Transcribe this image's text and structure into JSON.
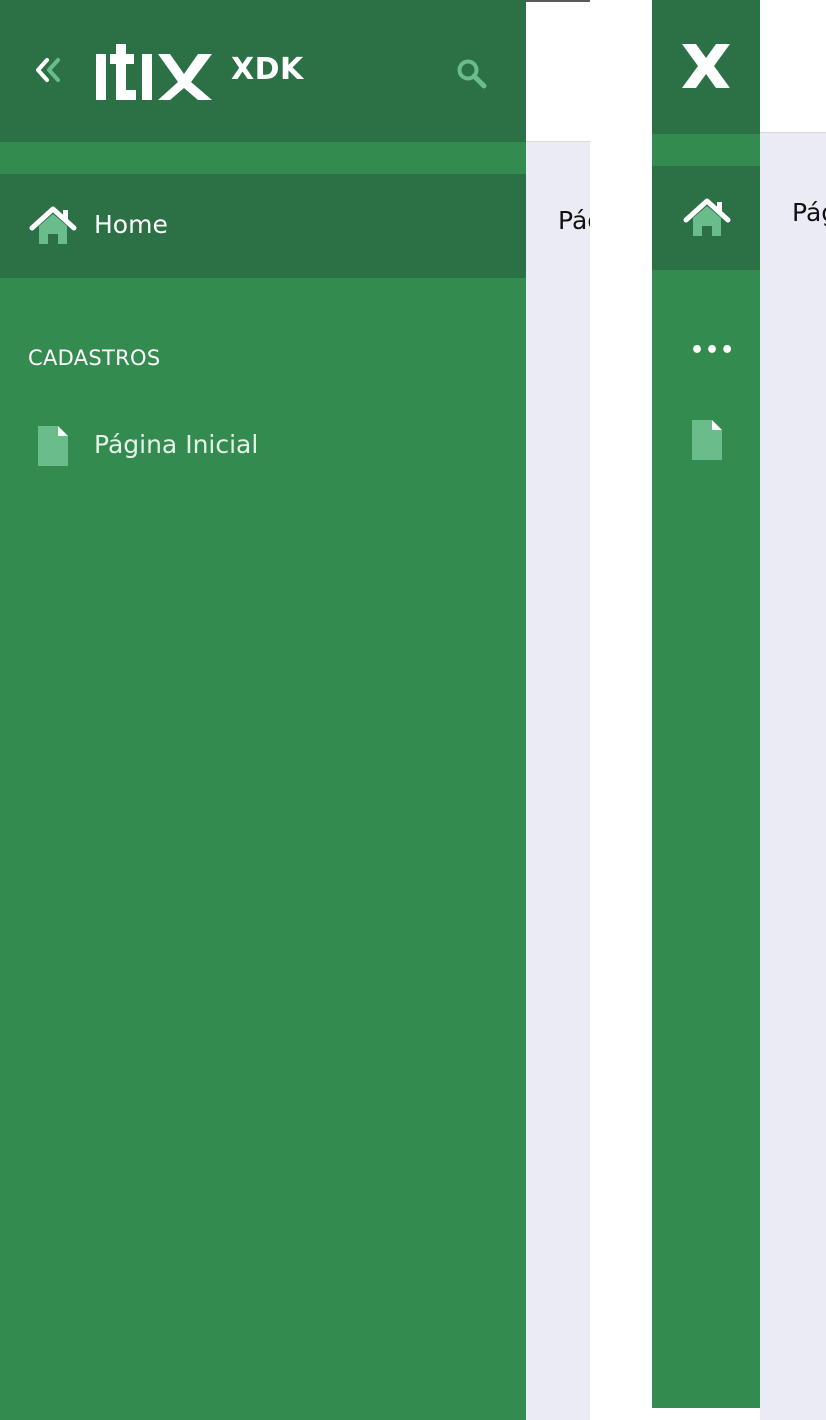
{
  "colors": {
    "sidebar_bg": "#348b50",
    "sidebar_header_bg": "#2c7046",
    "active_item_bg": "#2c7046",
    "icon_light_green": "#6abd8a",
    "content_bg": "#ebebf5"
  },
  "expanded": {
    "header": {
      "collapse_icon": "double-chevron-left-icon",
      "logo_alt": "itix",
      "brand_suffix": "XDK",
      "search_icon": "search-icon"
    },
    "home": {
      "icon": "home-icon",
      "label": "Home"
    },
    "sections": [
      {
        "title": "CADASTROS",
        "items": [
          {
            "icon": "file-icon",
            "label": "Página Inicial"
          }
        ]
      }
    ],
    "content_title": "Página Inicial"
  },
  "collapsed": {
    "logo_icon": "x-logo-icon",
    "home_icon": "home-icon",
    "more_label": "•••",
    "item_icon": "file-icon",
    "content_title": "Página Inicial"
  }
}
